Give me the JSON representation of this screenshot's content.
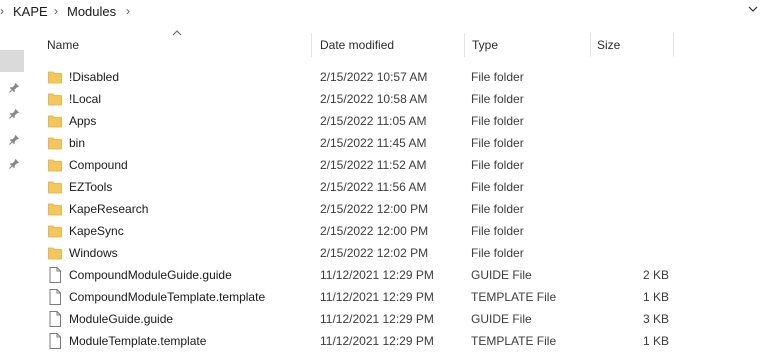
{
  "breadcrumb": {
    "root": "KAPE",
    "current": "Modules"
  },
  "columns": {
    "name": "Name",
    "date": "Date modified",
    "type": "Type",
    "size": "Size"
  },
  "files": [
    {
      "name": "!Disabled",
      "date": "2/15/2022 10:57 AM",
      "type": "File folder",
      "size": "",
      "icon": "folder-icon"
    },
    {
      "name": "!Local",
      "date": "2/15/2022 10:58 AM",
      "type": "File folder",
      "size": "",
      "icon": "folder-icon"
    },
    {
      "name": "Apps",
      "date": "2/15/2022 11:05 AM",
      "type": "File folder",
      "size": "",
      "icon": "folder-icon"
    },
    {
      "name": "bin",
      "date": "2/15/2022 11:45 AM",
      "type": "File folder",
      "size": "",
      "icon": "folder-icon"
    },
    {
      "name": "Compound",
      "date": "2/15/2022 11:52 AM",
      "type": "File folder",
      "size": "",
      "icon": "folder-icon"
    },
    {
      "name": "EZTools",
      "date": "2/15/2022 11:56 AM",
      "type": "File folder",
      "size": "",
      "icon": "folder-icon"
    },
    {
      "name": "KapeResearch",
      "date": "2/15/2022 12:00 PM",
      "type": "File folder",
      "size": "",
      "icon": "folder-icon"
    },
    {
      "name": "KapeSync",
      "date": "2/15/2022 12:00 PM",
      "type": "File folder",
      "size": "",
      "icon": "folder-icon"
    },
    {
      "name": "Windows",
      "date": "2/15/2022 12:02 PM",
      "type": "File folder",
      "size": "",
      "icon": "folder-icon"
    },
    {
      "name": "CompoundModuleGuide.guide",
      "date": "11/12/2021 12:29 PM",
      "type": "GUIDE File",
      "size": "2 KB",
      "icon": "file-icon"
    },
    {
      "name": "CompoundModuleTemplate.template",
      "date": "11/12/2021 12:29 PM",
      "type": "TEMPLATE File",
      "size": "1 KB",
      "icon": "file-icon"
    },
    {
      "name": "ModuleGuide.guide",
      "date": "11/12/2021 12:29 PM",
      "type": "GUIDE File",
      "size": "3 KB",
      "icon": "file-icon"
    },
    {
      "name": "ModuleTemplate.template",
      "date": "11/12/2021 12:29 PM",
      "type": "TEMPLATE File",
      "size": "1 KB",
      "icon": "file-icon"
    }
  ],
  "colors": {
    "folder": "#f4c75d",
    "folder_dark": "#e2ad33",
    "file_border": "#7a7a7a",
    "selected": "#dadada"
  }
}
